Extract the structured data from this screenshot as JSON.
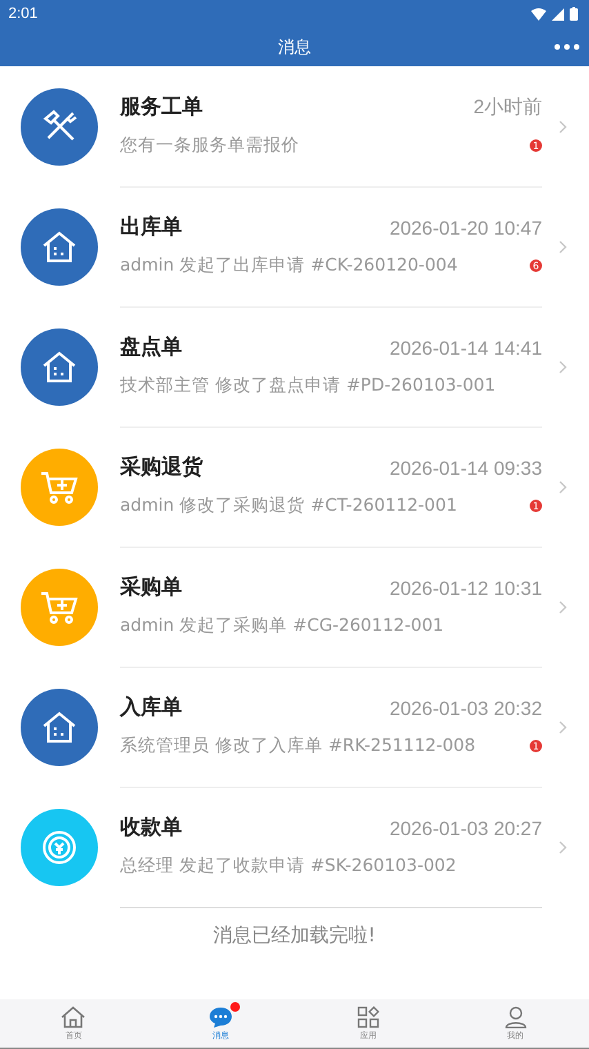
{
  "status_bar": {
    "time": "2:01"
  },
  "header": {
    "title": "消息"
  },
  "messages": [
    {
      "kind": "tools",
      "color": "#2f6cb8",
      "title": "服务工单",
      "time": "2小时前",
      "summary": "您有一条服务单需报价",
      "badge": "1"
    },
    {
      "kind": "house",
      "color": "#2f6cb8",
      "title": "出库单",
      "time": "2026-01-20 10:47",
      "summary": "admin 发起了出库申请 #CK-260120-004",
      "badge": "6"
    },
    {
      "kind": "house",
      "color": "#2f6cb8",
      "title": "盘点单",
      "time": "2026-01-14 14:41",
      "summary": "技术部主管 修改了盘点申请 #PD-260103-001"
    },
    {
      "kind": "cart",
      "color": "#ffad00",
      "title": "采购退货",
      "time": "2026-01-14 09:33",
      "summary": "admin 修改了采购退货 #CT-260112-001",
      "badge": "1"
    },
    {
      "kind": "cart",
      "color": "#ffad00",
      "title": "采购单",
      "time": "2026-01-12 10:31",
      "summary": "admin 发起了采购单 #CG-260112-001"
    },
    {
      "kind": "house",
      "color": "#2f6cb8",
      "title": "入库单",
      "time": "2026-01-03 20:32",
      "summary": "系统管理员 修改了入库单 #RK-251112-008",
      "badge": "1"
    },
    {
      "kind": "coin",
      "color": "#17c6f2",
      "title": "收款单",
      "time": "2026-01-03 20:27",
      "summary": "总经理 发起了收款申请 #SK-260103-002"
    }
  ],
  "footer_note": "消息已经加载完啦!",
  "tabs": [
    {
      "kind": "home",
      "label": "首页",
      "selected": false,
      "dot": false
    },
    {
      "kind": "chat",
      "label": "消息",
      "selected": true,
      "dot": true
    },
    {
      "kind": "apps",
      "label": "应用",
      "selected": false,
      "dot": false
    },
    {
      "kind": "user",
      "label": "我的",
      "selected": false,
      "dot": false
    }
  ]
}
